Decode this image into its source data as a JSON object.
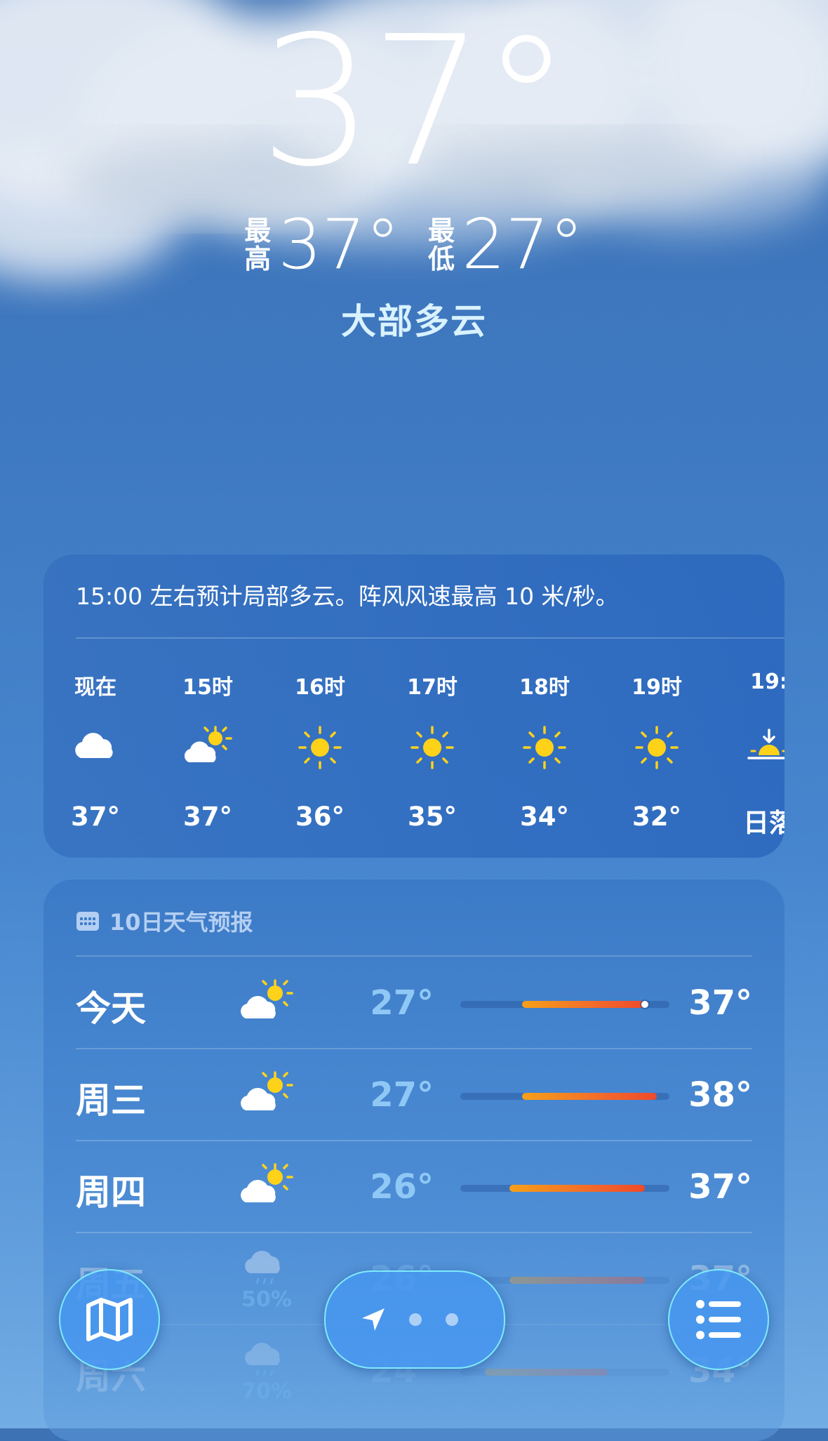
{
  "current": {
    "temp": "37°",
    "high_label": "最高",
    "high": "37°",
    "low_label": "最低",
    "low": "27°",
    "condition": "大部多云"
  },
  "hourly": {
    "summary": "15:00 左右预计局部多云。阵风风速最高 10 米/秒。",
    "items": [
      {
        "time": "现在",
        "icon": "cloud-icon",
        "temp": "37°"
      },
      {
        "time": "15时",
        "icon": "partly-sunny-icon",
        "temp": "37°"
      },
      {
        "time": "16时",
        "icon": "sun-icon",
        "temp": "36°"
      },
      {
        "time": "17时",
        "icon": "sun-icon",
        "temp": "35°"
      },
      {
        "time": "18时",
        "icon": "sun-icon",
        "temp": "34°"
      },
      {
        "time": "19时",
        "icon": "sun-icon",
        "temp": "32°"
      },
      {
        "time": "19:",
        "icon": "sunset-icon",
        "temp": "日落"
      }
    ]
  },
  "forecast": {
    "title": "10日天气预报",
    "days": [
      {
        "day": "今天",
        "icon": "partly-sunny-icon",
        "pop": "",
        "low": "27°",
        "high": "37°"
      },
      {
        "day": "周三",
        "icon": "partly-sunny-icon",
        "pop": "",
        "low": "27°",
        "high": "38°"
      },
      {
        "day": "周四",
        "icon": "partly-sunny-icon",
        "pop": "",
        "low": "26°",
        "high": "37°"
      },
      {
        "day": "周五",
        "icon": "rain-cloud-icon",
        "pop": "50%",
        "low": "26°",
        "high": "37°"
      },
      {
        "day": "周六",
        "icon": "rain-cloud-icon",
        "pop": "70%",
        "low": "24°",
        "high": "34°"
      }
    ],
    "range": {
      "min": 22,
      "max": 39
    },
    "current_temp_value": 37
  },
  "colors": {
    "background_top": "#3d72b5",
    "background_bottom": "#73ade4",
    "sun": "#ffd21a",
    "bar_warm": "#f36a2a",
    "popup_blue": "#7fd0ff",
    "control_fill": "#4696f0",
    "control_border": "#8cffff"
  },
  "controls": {
    "map": "map-icon",
    "location": "location-arrow-icon",
    "list": "list-icon"
  }
}
